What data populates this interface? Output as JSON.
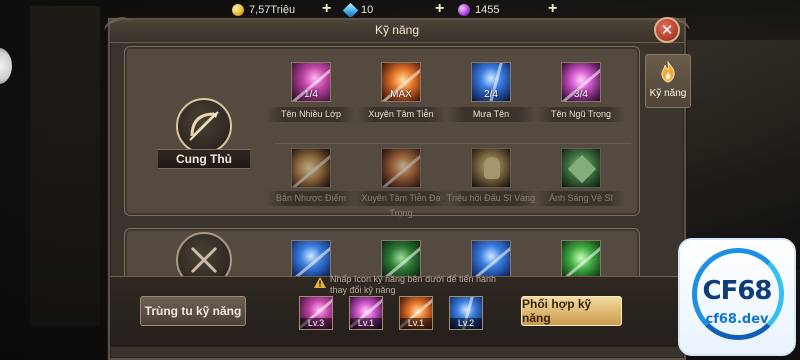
{
  "resources": {
    "gold": "7,57Triệu",
    "diamond": "10",
    "orb": "1455",
    "add_label": "+"
  },
  "window": {
    "title": "Kỹ năng",
    "close_label": "✕"
  },
  "side_tab": {
    "label": "Kỹ năng"
  },
  "classes": [
    {
      "name": "Cung Thủ",
      "skills": [
        {
          "name": "Tên Nhiều Lớp",
          "badge": "1/4",
          "icon": "pink-arrow-icon"
        },
        {
          "name": "Xuyên Tâm Tiễn",
          "badge": "MAX",
          "icon": "fire-arrow-icon"
        },
        {
          "name": "Mưa Tên",
          "badge": "2/4",
          "icon": "blue-arrow-rain-icon"
        },
        {
          "name": "Tên Ngũ Trọng",
          "badge": "3/4",
          "icon": "magenta-arrows-icon"
        },
        {
          "name": "Bắn Nhược Điểm",
          "badge": "",
          "icon": "amber-arrows-icon"
        },
        {
          "name": "Xuyên Tâm Tiễn Đa Trọng",
          "badge": "",
          "icon": "fire-multi-arrow-icon"
        },
        {
          "name": "Triệu hồi Đấu Sĩ Vàng",
          "badge": "",
          "icon": "golden-warrior-icon"
        },
        {
          "name": "Ánh Sáng Vệ Sĩ",
          "badge": "",
          "icon": "green-guardian-icon"
        }
      ]
    }
  ],
  "hint_text": "Nhấp Icon kỹ năng bên dưới để tiến hành thay đổi kỹ năng",
  "buttons": {
    "train": "Trùng tu kỹ năng",
    "combine": "Phối hợp kỹ năng"
  },
  "equipped": [
    {
      "badge": "Lv.3",
      "icon": "pink-arrow-icon"
    },
    {
      "badge": "Lv.1",
      "icon": "magenta-arrows-icon"
    },
    {
      "badge": "Lv.1",
      "icon": "fire-arrow-icon"
    },
    {
      "badge": "Lv.2",
      "icon": "blue-arrow-rain-icon"
    }
  ],
  "logo": {
    "text": "CF68",
    "subtext": "cf68.dev"
  }
}
